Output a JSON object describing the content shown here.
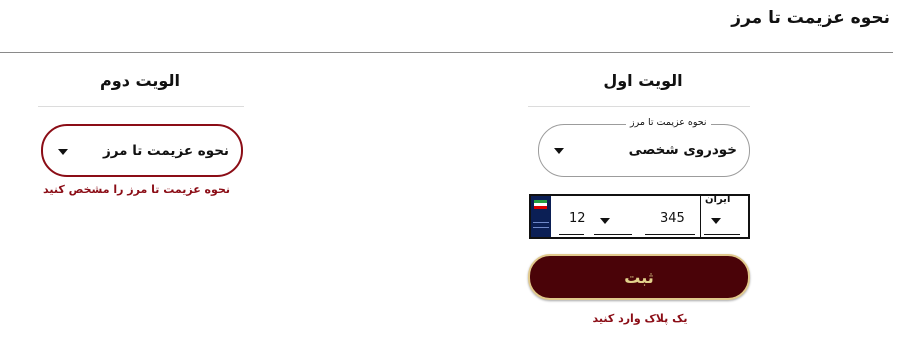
{
  "page_title": "نحوه عزیمت تا مرز",
  "second_vehicle": {
    "heading": "الویت دوم",
    "select_value": "نحوه عزیمت تا مرز",
    "error": "نحوه عزیمت تا مرز را مشخص کنید"
  },
  "first_vehicle": {
    "heading": "الویت اول",
    "select_label": "نحوه عزیمت تا مرز",
    "select_value": "خودروی شخصی",
    "plate": {
      "country_label": "ایران",
      "number": "345",
      "two_digit": "12"
    },
    "submit_label": "ثبت",
    "error": "یک پلاک وارد کنید"
  },
  "colors": {
    "error_red": "#8b0d16",
    "button_bg": "#4a0308",
    "button_text": "#e2d28c"
  }
}
